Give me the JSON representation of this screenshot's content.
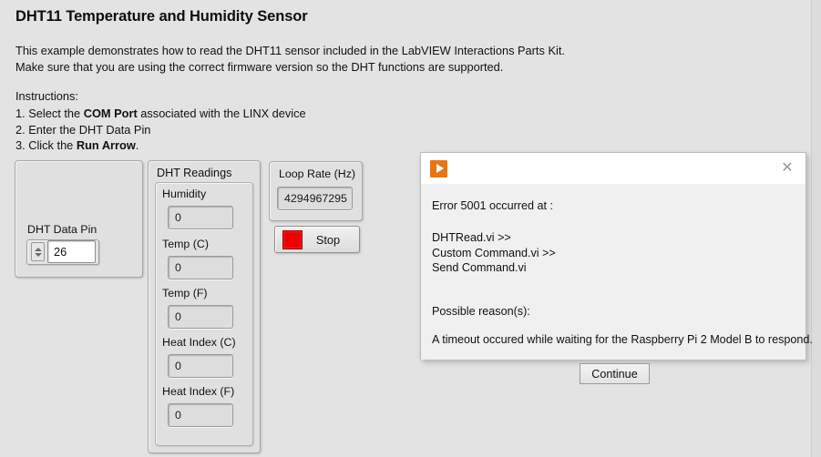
{
  "vi": {
    "title": "DHT11 Temperature and Humidity Sensor",
    "description": "This example demonstrates how to read the DHT11 sensor included in the LabVIEW Interactions Parts Kit.\nMake sure that you are using the correct firmware version so the DHT functions are supported.",
    "instructions_heading": "Instructions:",
    "instructions": [
      {
        "prefix": "1. Select the ",
        "bold": "COM Port",
        "suffix": " associated with the LINX device"
      },
      {
        "prefix": "2. Enter the DHT Data Pin",
        "bold": "",
        "suffix": ""
      },
      {
        "prefix": "3. Click the ",
        "bold": "Run Arrow",
        "suffix": "."
      }
    ]
  },
  "data_pin": {
    "label": "DHT Data Pin",
    "value": "26",
    "increment_icon": "spinner-up-icon",
    "decrement_icon": "spinner-down-icon"
  },
  "readings": {
    "title": "DHT Readings",
    "items": [
      {
        "label": "Humidity",
        "value": "0"
      },
      {
        "label": "Temp (C)",
        "value": "0"
      },
      {
        "label": "Temp (F)",
        "value": "0"
      },
      {
        "label": "Heat Index (C)",
        "value": "0"
      },
      {
        "label": "Heat Index (F)",
        "value": "0"
      }
    ]
  },
  "loop_rate": {
    "label": "Loop Rate (Hz)",
    "value": "4294967295"
  },
  "stop_button": {
    "label": "Stop",
    "led_color": "#ee0000",
    "led_icon": "stop-square-icon"
  },
  "error_dialog": {
    "app_icon": "labview-run-arrow-icon",
    "close_icon": "close-icon",
    "close_glyph": "✕",
    "error_line": "Error 5001 occurred at :",
    "call_chain": "DHTRead.vi >>\nCustom Command.vi >>\nSend Command.vi",
    "reason_heading": "Possible reason(s):",
    "reason_text": "A timeout occured while waiting for the Raspberry Pi 2 Model B to respond.",
    "continue_label": "Continue"
  },
  "colors": {
    "panel_background": "#e3e3e3",
    "accent_orange": "#e87511",
    "dialog_background": "#f0f0f0"
  }
}
